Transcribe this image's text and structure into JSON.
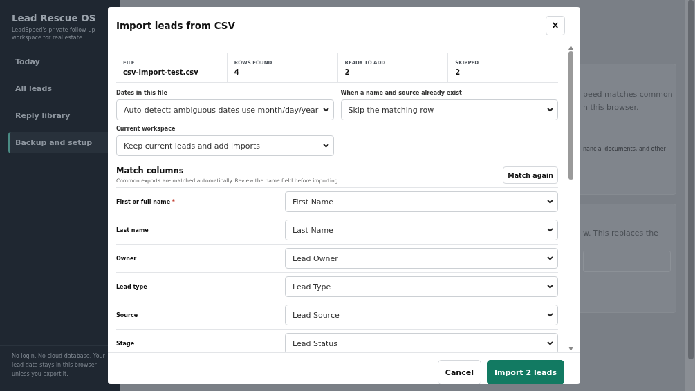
{
  "sidebar": {
    "title": "Lead Rescue OS",
    "subtitle": "LeadSpeed's private follow-up workspace for real estate.",
    "items": [
      {
        "label": "Today",
        "selected": false
      },
      {
        "label": "All leads",
        "selected": false
      },
      {
        "label": "Reply library",
        "selected": false
      },
      {
        "label": "Backup and setup",
        "selected": true
      }
    ],
    "footer": "No login. No cloud database. Your lead data stays in this browser unless you export it."
  },
  "background_cards": [
    {
      "lines": [
        "peed matches common",
        "n this browser."
      ],
      "note": "nancial documents, and other"
    },
    {
      "lines": [
        "w. This replaces the"
      ],
      "field": true
    }
  ],
  "dialog": {
    "title": "Import leads from CSV",
    "close": "×",
    "summary": [
      {
        "label": "FILE",
        "value": "csv-import-test.csv"
      },
      {
        "label": "ROWS FOUND",
        "value": "4"
      },
      {
        "label": "READY TO ADD",
        "value": "2"
      },
      {
        "label": "SKIPPED",
        "value": "2"
      }
    ],
    "options": [
      {
        "label": "Dates in this file",
        "value": "Auto-detect; ambiguous dates use month/day/year"
      },
      {
        "label": "When a name and source already exist",
        "value": "Skip the matching row"
      },
      {
        "label": "Current workspace",
        "value": "Keep current leads and add imports"
      }
    ],
    "match": {
      "title": "Match columns",
      "hint": "Common exports are matched automatically. Review the name field before importing.",
      "button": "Match again",
      "required_mark": "*",
      "rows": [
        {
          "field": "First or full name",
          "required": true,
          "column": "First Name"
        },
        {
          "field": "Last name",
          "required": false,
          "column": "Last Name"
        },
        {
          "field": "Owner",
          "required": false,
          "column": "Lead Owner"
        },
        {
          "field": "Lead type",
          "required": false,
          "column": "Lead Type"
        },
        {
          "field": "Source",
          "required": false,
          "column": "Lead Source"
        },
        {
          "field": "Stage",
          "required": false,
          "column": "Lead Status"
        }
      ]
    },
    "buttons": [
      {
        "label": "Cancel",
        "kind": "secondary"
      },
      {
        "label": "Import 2 leads",
        "kind": "primary"
      }
    ]
  }
}
